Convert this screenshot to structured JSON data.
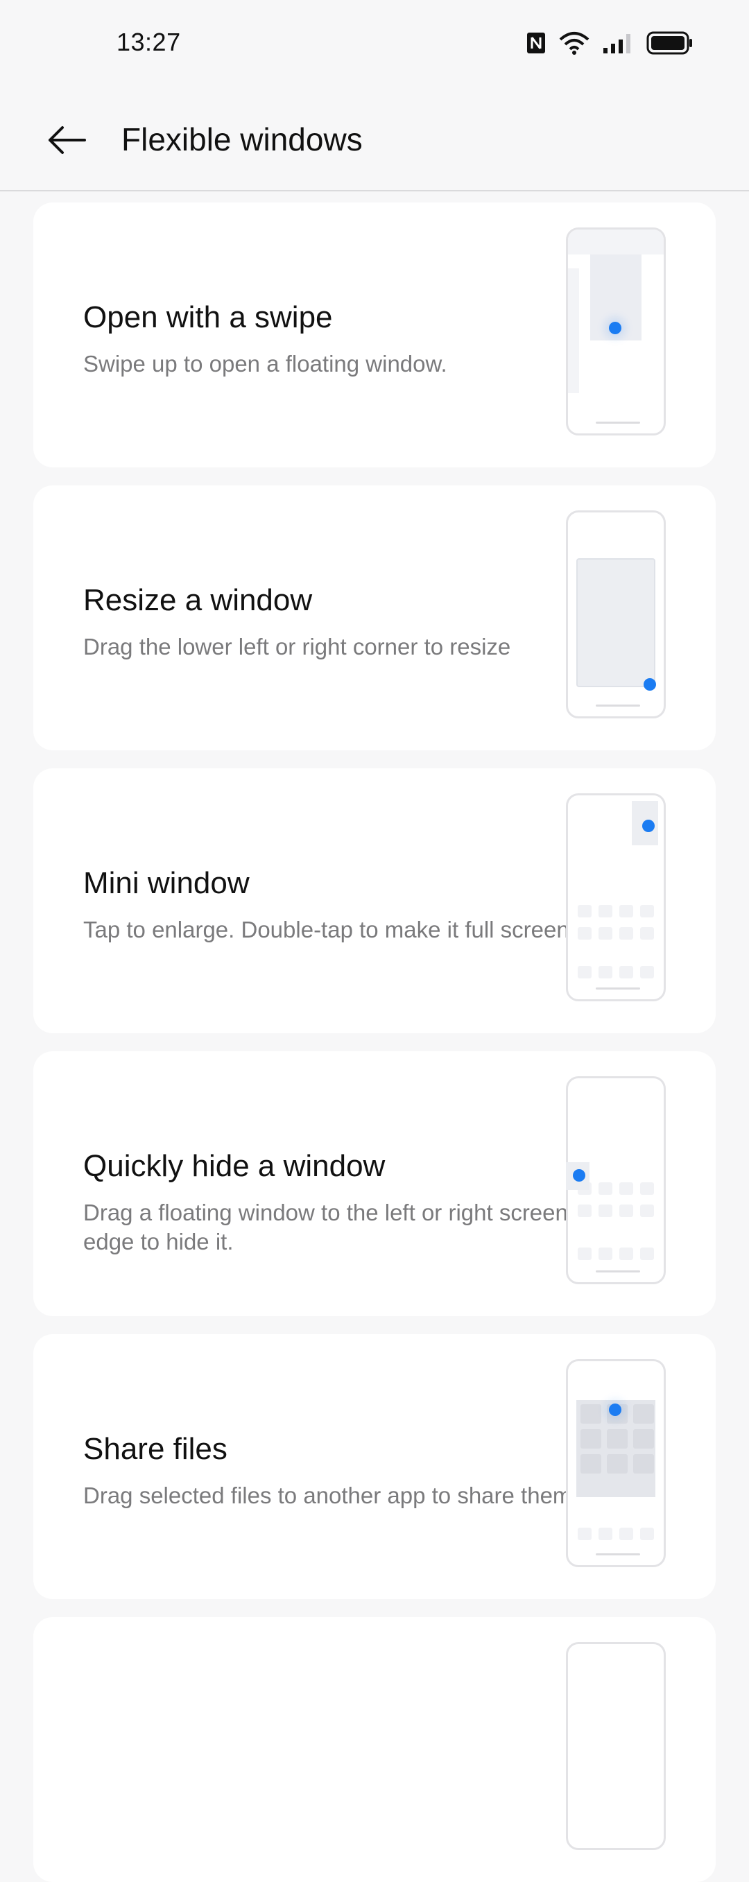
{
  "status_bar": {
    "time": "13:27",
    "icons": [
      "nfc-icon",
      "wifi-icon",
      "signal-icon",
      "battery-icon"
    ]
  },
  "header": {
    "title": "Flexible windows",
    "back_icon": "back-arrow-icon"
  },
  "cards": [
    {
      "title": "Open with a swipe",
      "desc": "Swipe up to open a floating window."
    },
    {
      "title": "Resize a window",
      "desc": "Drag the lower left or right corner to resize"
    },
    {
      "title": "Mini window",
      "desc": "Tap to enlarge. Double-tap to make it full screen."
    },
    {
      "title": "Quickly hide a window",
      "desc": "Drag a floating window to the left or right screen edge to hide it."
    },
    {
      "title": "Share files",
      "desc": "Drag selected files to another app to share them."
    }
  ],
  "colors": {
    "accent": "#1b7cf2",
    "background": "#f7f7f8",
    "card": "#ffffff",
    "secondary_text": "#7a7a7c"
  }
}
